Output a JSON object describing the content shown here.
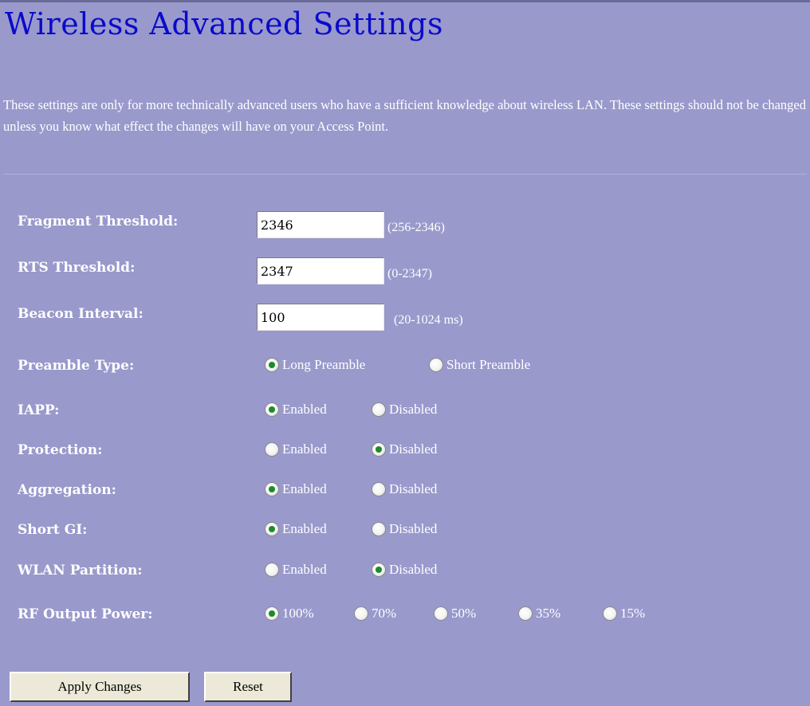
{
  "page": {
    "title": "Wireless Advanced Settings",
    "intro": "These settings are only for more technically advanced users who have a sufficient knowledge about wireless LAN. These settings should not be changed unless you know what effect the changes will have on your Access Point."
  },
  "fields": {
    "fragment": {
      "label": "Fragment Threshold:",
      "value": "2346",
      "hint": "(256-2346)"
    },
    "rts": {
      "label": "RTS Threshold:",
      "value": "2347",
      "hint": "(0-2347)"
    },
    "beacon": {
      "label": "Beacon Interval:",
      "value": "100",
      "hint": "(20-1024 ms)"
    }
  },
  "radios": {
    "preamble": {
      "label": "Preamble Type:",
      "options": [
        "Long Preamble",
        "Short Preamble"
      ],
      "selected": "Long Preamble"
    },
    "iapp": {
      "label": "IAPP:",
      "options": [
        "Enabled",
        "Disabled"
      ],
      "selected": "Enabled"
    },
    "protection": {
      "label": "Protection:",
      "options": [
        "Enabled",
        "Disabled"
      ],
      "selected": "Disabled"
    },
    "aggregation": {
      "label": "Aggregation:",
      "options": [
        "Enabled",
        "Disabled"
      ],
      "selected": "Enabled"
    },
    "shortgi": {
      "label": "Short GI:",
      "options": [
        "Enabled",
        "Disabled"
      ],
      "selected": "Enabled"
    },
    "partition": {
      "label": "WLAN Partition:",
      "options": [
        "Enabled",
        "Disabled"
      ],
      "selected": "Disabled"
    },
    "rfpower": {
      "label": "RF Output Power:",
      "options": [
        "100%",
        "70%",
        "50%",
        "35%",
        "15%"
      ],
      "selected": "100%"
    }
  },
  "buttons": {
    "apply": "Apply Changes",
    "reset": "Reset"
  },
  "colors": {
    "background": "#9999cc",
    "title": "#0a0acc",
    "radio_dot": "#1e8a2c"
  }
}
